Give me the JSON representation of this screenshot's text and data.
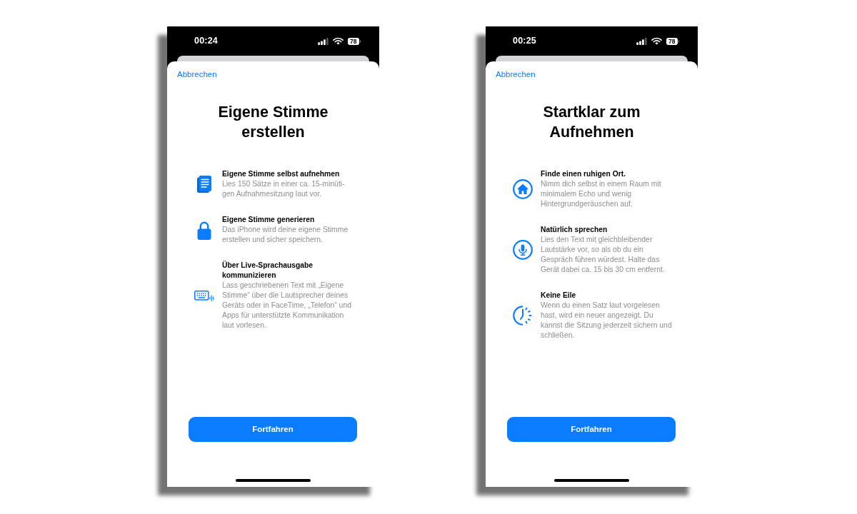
{
  "phones": [
    {
      "status_bar": {
        "time": "00:24",
        "battery": "78"
      },
      "cancel_link": "Abbrechen",
      "title": "Eigene Stimme erstellen",
      "features": [
        {
          "kind": "document",
          "title": "Eigene Stimme selbst aufnehmen",
          "description": "Lies 150 Sätze in einer ca. 15-minüti-gen Aufnahmesitzung laut vor."
        },
        {
          "kind": "lock",
          "title": "Eigene Stimme generieren",
          "description": "Das iPhone wird deine eigene Stimme erstellen und sicher speichern."
        },
        {
          "kind": "keyboard",
          "title": "Über Live-Sprachausgabe kommunizieren",
          "description": "Lass geschriebenen Text mit „Eigene Stimme“ über die Lautsprecher deines Geräts oder in FaceTime, „Telefon“ und Apps für unterstützte Kommunikation laut vorlesen."
        }
      ],
      "button": "Fortfahren"
    },
    {
      "status_bar": {
        "time": "00:25",
        "battery": "78"
      },
      "cancel_link": "Abbrechen",
      "title": "Startklar zum Aufnehmen",
      "features": [
        {
          "kind": "house",
          "title": "Finde einen ruhigen Ort.",
          "description": "Nimm dich selbst in einem Raum mit minimalem Echo und wenig Hintergrundgeräuschen auf."
        },
        {
          "kind": "microphone",
          "title": "Natürlich sprechen",
          "description": "Lies den Text mit gleichbleibender Lautstärke vor, so als ob du ein Gespräch führen würdest. Halte das Gerät dabei ca. 15 bis 30 cm entfernt."
        },
        {
          "kind": "clock",
          "title": "Keine Eile",
          "description": "Wenn du einen Satz laut vorgelesen hast, wird ein neuer angezeigt. Du kannst die Sitzung jederzeit sichern und schließen."
        }
      ],
      "button": "Fortfahren"
    }
  ]
}
